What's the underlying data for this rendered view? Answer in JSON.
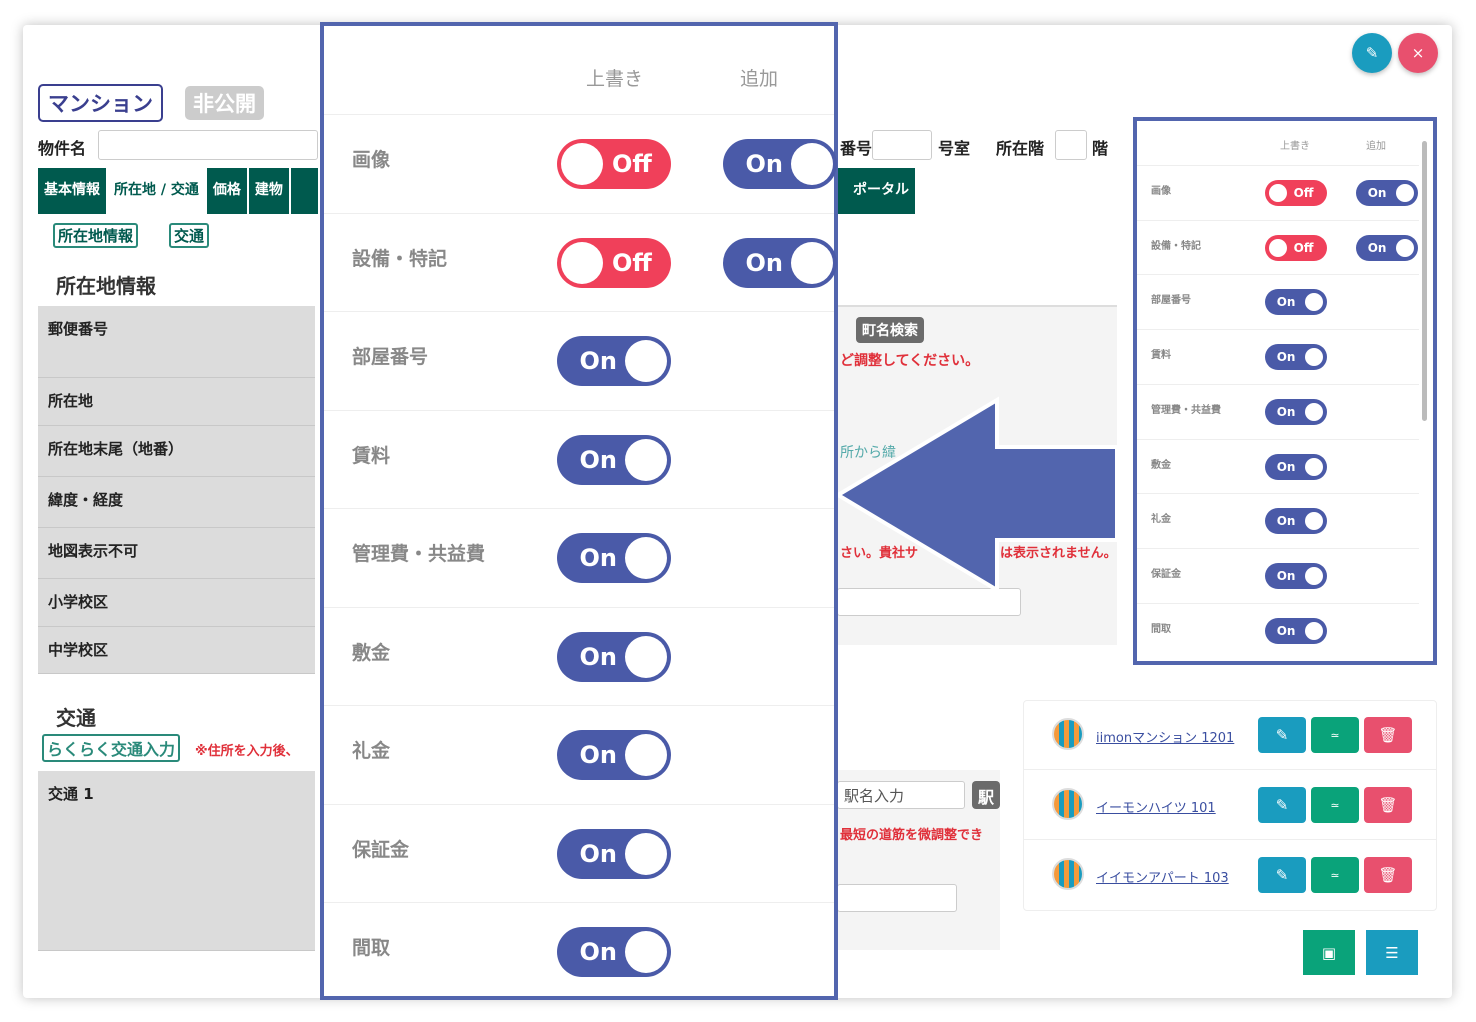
{
  "header": {
    "type_badge": "マンション",
    "status_badge": "非公開",
    "name_label": "物件名",
    "room_label": "番号",
    "room_unit": "号室",
    "floor_label": "所在階",
    "floor_unit": "階"
  },
  "tabs": [
    "基本情報",
    "所在地 / 交通",
    "価格",
    "建物",
    "ポータル"
  ],
  "subtabs": [
    "所在地情報",
    "交通"
  ],
  "section_location": {
    "title": "所在地情報",
    "rows": [
      "郵便番号",
      "所在地",
      "所在地末尾（地番）",
      "緯度・経度",
      "地図表示不可",
      "小学校区",
      "中学校区"
    ],
    "town_search": "町名検索",
    "note1": "ど調整してください。",
    "note2": "さい。貴社サ",
    "note3": "は表示されません。",
    "link_partial": "所から緯"
  },
  "section_traffic": {
    "title": "交通",
    "easy_input": "らくらく交通入力",
    "note": "※住所を入力後、",
    "row": "交通 1",
    "station_placeholder": "駅名入力",
    "station_btn": "駅",
    "note_route": "最短の道筋を微調整でき"
  },
  "override_panel": {
    "col_overwrite": "上書き",
    "col_add": "追加",
    "rows": [
      {
        "label": "画像",
        "overwrite": "Off",
        "add": "On"
      },
      {
        "label": "設備・特記",
        "overwrite": "Off",
        "add": "On"
      },
      {
        "label": "部屋番号",
        "overwrite": "On"
      },
      {
        "label": "賃料",
        "overwrite": "On"
      },
      {
        "label": "管理費・共益費",
        "overwrite": "On"
      },
      {
        "label": "敷金",
        "overwrite": "On"
      },
      {
        "label": "礼金",
        "overwrite": "On"
      },
      {
        "label": "保証金",
        "overwrite": "On"
      },
      {
        "label": "間取",
        "overwrite": "On"
      }
    ]
  },
  "properties": [
    {
      "name": "iimonマンション 1201"
    },
    {
      "name": "イーモンハイツ 101"
    },
    {
      "name": "イイモンアパート 103"
    }
  ],
  "colors": {
    "accent": "#5265ae",
    "on": "#4a5aa8",
    "off": "#f0405a",
    "tab": "#005a4e",
    "edit": "#1a9cbf",
    "copy": "#0aa37a",
    "delete": "#e8506e"
  }
}
